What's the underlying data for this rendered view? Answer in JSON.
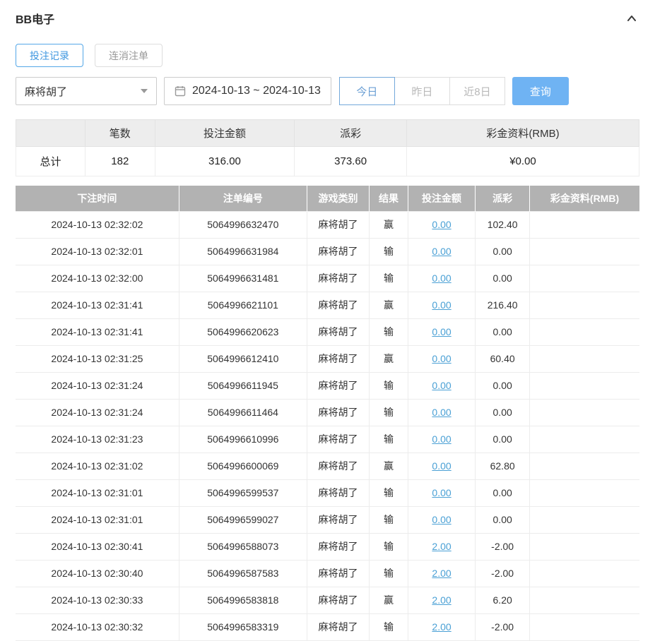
{
  "page": {
    "title": "BB电子"
  },
  "tabs": [
    {
      "label": "投注记录",
      "active": true
    },
    {
      "label": "连消注单",
      "active": false
    }
  ],
  "filters": {
    "game_select": "麻将胡了",
    "date_range": "2024-10-13 ~ 2024-10-13",
    "quick": [
      {
        "label": "今日",
        "active": true
      },
      {
        "label": "昨日",
        "active": false
      },
      {
        "label": "近8日",
        "active": false
      }
    ],
    "query_label": "查询"
  },
  "summary": {
    "headers": [
      "",
      "笔数",
      "投注金额",
      "派彩",
      "彩金资料(RMB)"
    ],
    "total_label": "总计",
    "count": "182",
    "bet_amount": "316.00",
    "payout": "373.60",
    "jackpot": "¥0.00"
  },
  "table": {
    "headers": [
      "下注时间",
      "注单编号",
      "游戏类别",
      "结果",
      "投注金额",
      "派彩",
      "彩金资料(RMB)"
    ],
    "rows": [
      {
        "time": "2024-10-13 02:32:02",
        "order": "5064996632470",
        "game": "麻将胡了",
        "result": "赢",
        "bet": "0.00",
        "payout": "102.40",
        "jackpot": ""
      },
      {
        "time": "2024-10-13 02:32:01",
        "order": "5064996631984",
        "game": "麻将胡了",
        "result": "输",
        "bet": "0.00",
        "payout": "0.00",
        "jackpot": ""
      },
      {
        "time": "2024-10-13 02:32:00",
        "order": "5064996631481",
        "game": "麻将胡了",
        "result": "输",
        "bet": "0.00",
        "payout": "0.00",
        "jackpot": ""
      },
      {
        "time": "2024-10-13 02:31:41",
        "order": "5064996621101",
        "game": "麻将胡了",
        "result": "赢",
        "bet": "0.00",
        "payout": "216.40",
        "jackpot": ""
      },
      {
        "time": "2024-10-13 02:31:41",
        "order": "5064996620623",
        "game": "麻将胡了",
        "result": "输",
        "bet": "0.00",
        "payout": "0.00",
        "jackpot": ""
      },
      {
        "time": "2024-10-13 02:31:25",
        "order": "5064996612410",
        "game": "麻将胡了",
        "result": "赢",
        "bet": "0.00",
        "payout": "60.40",
        "jackpot": ""
      },
      {
        "time": "2024-10-13 02:31:24",
        "order": "5064996611945",
        "game": "麻将胡了",
        "result": "输",
        "bet": "0.00",
        "payout": "0.00",
        "jackpot": ""
      },
      {
        "time": "2024-10-13 02:31:24",
        "order": "5064996611464",
        "game": "麻将胡了",
        "result": "输",
        "bet": "0.00",
        "payout": "0.00",
        "jackpot": ""
      },
      {
        "time": "2024-10-13 02:31:23",
        "order": "5064996610996",
        "game": "麻将胡了",
        "result": "输",
        "bet": "0.00",
        "payout": "0.00",
        "jackpot": ""
      },
      {
        "time": "2024-10-13 02:31:02",
        "order": "5064996600069",
        "game": "麻将胡了",
        "result": "赢",
        "bet": "0.00",
        "payout": "62.80",
        "jackpot": ""
      },
      {
        "time": "2024-10-13 02:31:01",
        "order": "5064996599537",
        "game": "麻将胡了",
        "result": "输",
        "bet": "0.00",
        "payout": "0.00",
        "jackpot": ""
      },
      {
        "time": "2024-10-13 02:31:01",
        "order": "5064996599027",
        "game": "麻将胡了",
        "result": "输",
        "bet": "0.00",
        "payout": "0.00",
        "jackpot": ""
      },
      {
        "time": "2024-10-13 02:30:41",
        "order": "5064996588073",
        "game": "麻将胡了",
        "result": "输",
        "bet": "2.00",
        "payout": "-2.00",
        "jackpot": ""
      },
      {
        "time": "2024-10-13 02:30:40",
        "order": "5064996587583",
        "game": "麻将胡了",
        "result": "输",
        "bet": "2.00",
        "payout": "-2.00",
        "jackpot": ""
      },
      {
        "time": "2024-10-13 02:30:33",
        "order": "5064996583818",
        "game": "麻将胡了",
        "result": "赢",
        "bet": "2.00",
        "payout": "6.20",
        "jackpot": ""
      },
      {
        "time": "2024-10-13 02:30:32",
        "order": "5064996583319",
        "game": "麻将胡了",
        "result": "输",
        "bet": "2.00",
        "payout": "-2.00",
        "jackpot": ""
      }
    ]
  },
  "colors": {
    "accent_blue": "#6fb3f3",
    "active_tab_blue": "#3f97e0",
    "link_blue": "#4aa0d5",
    "negative_red": "#f05c5c",
    "table_header_bg": "#b2b2b2"
  }
}
